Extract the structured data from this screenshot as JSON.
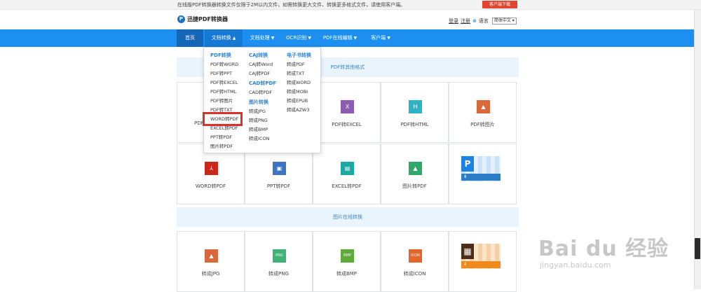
{
  "topbar": {
    "notice": "在线版PDF转换器转换文件仅限于2M以内文件，如需转换更大文件、转换更多格式文件，请使用客户端。",
    "client_download": "客户端下载"
  },
  "header": {
    "logo_text": "迅捷PDF转换器",
    "login": "登录",
    "register": "注册",
    "language_label": "语言",
    "language_value": "简体中文"
  },
  "nav": {
    "items": [
      {
        "label": "首页"
      },
      {
        "label": "文档转换"
      },
      {
        "label": "文档处理"
      },
      {
        "label": "OCR识别"
      },
      {
        "label": "PDF在线编辑"
      },
      {
        "label": "客户端"
      }
    ]
  },
  "dropdown": {
    "col1": {
      "heading": "PDF转换",
      "items": [
        "PDF转WORD",
        "PDF转PPT",
        "PDF转EXCEL",
        "PDF转HTML",
        "PDF转图片",
        "PDF转TXT",
        "WORD转PDF",
        "EXCEL转PDF",
        "PPT转PDF",
        "图片转PDF"
      ]
    },
    "col2": {
      "heading": "CAJ转换",
      "items": [
        "CAJ转Word",
        "CAJ转PDF"
      ],
      "heading2": "CAD转PDF",
      "items2": [
        "CAD转PDF"
      ],
      "heading3": "图片转换",
      "items3": [
        "转成JPG",
        "转成PNG",
        "转成BMP",
        "转成ICON"
      ]
    },
    "col3": {
      "heading": "电子书转换",
      "items": [
        "转成PDF",
        "转成TXT",
        "转成WORD",
        "转成MOBI",
        "转成EPUB",
        "转成AZW3"
      ]
    }
  },
  "sections": {
    "pdf_convert": "PDF转其他格式",
    "image_convert": "图片在线转换"
  },
  "tiles": {
    "row1": [
      {
        "label": "PDF转",
        "icon": "W",
        "color": "#2b64b2"
      },
      {
        "label": "PDF转EXCEL",
        "icon": "X",
        "color": "#8e5bb0"
      },
      {
        "label": "PDF转HTML",
        "icon": "H",
        "color": "#2bb3c7"
      },
      {
        "label": "PDF转图片",
        "icon": "▲",
        "color": "#d9683a"
      }
    ],
    "row2": [
      {
        "label": "WORD转PDF",
        "icon": "⅄",
        "color": "#c9291d"
      },
      {
        "label": "PPT转PDF",
        "icon": "▣",
        "color": "#3f74c3"
      },
      {
        "label": "EXCEL转PDF",
        "icon": "▤",
        "color": "#1ba9a5"
      },
      {
        "label": "图片转PDF",
        "icon": "▲",
        "color": "#2fa86a"
      }
    ],
    "row3": [
      {
        "label": "转成JPG",
        "icon": "▲",
        "color": "#d9683a"
      },
      {
        "label": "转成PNG",
        "icon": "PNG",
        "color": "#3fb276"
      },
      {
        "label": "转成BMP",
        "icon": "BMP",
        "color": "#5dab3b"
      },
      {
        "label": "转成ICON",
        "icon": "ICON",
        "color": "#e3662b"
      }
    ],
    "promo_logo_1": "P",
    "promo_logo_2": "▦"
  },
  "watermark": {
    "logo": "Bai du 经验",
    "url": "jingyan.baidu.com"
  }
}
